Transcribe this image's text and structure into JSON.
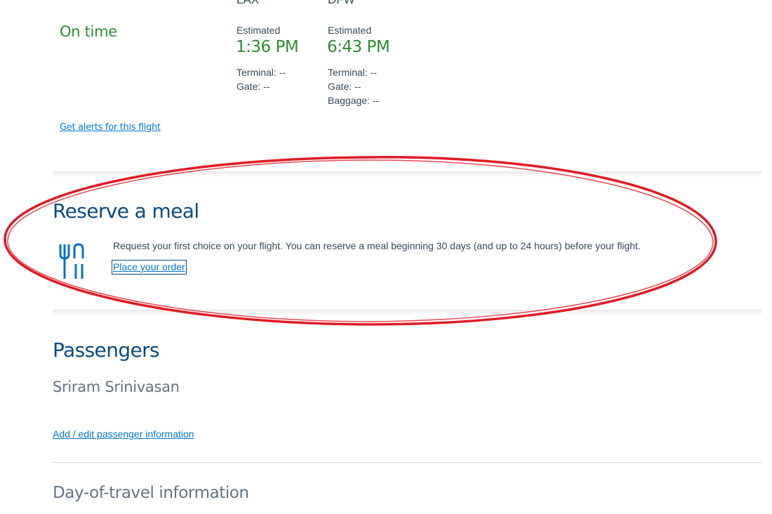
{
  "flight": {
    "status": "On time",
    "origin": {
      "code": "LAX",
      "estimated_label": "Estimated",
      "estimated_time": "1:36 PM",
      "terminal": "Terminal: --",
      "gate": "Gate: --"
    },
    "destination": {
      "code": "DFW",
      "estimated_label": "Estimated",
      "estimated_time": "6:43 PM",
      "terminal": "Terminal: --",
      "gate": "Gate: --",
      "baggage": "Baggage: --"
    },
    "alerts_link": "Get alerts for this flight"
  },
  "meal": {
    "title": "Reserve a meal",
    "icon": "utensils-icon",
    "description": "Request your first choice on your flight. You can reserve a meal beginning 30 days (and up to 24 hours) before your flight.",
    "order_link": "Place your order"
  },
  "passengers": {
    "title": "Passengers",
    "names": [
      "Sriram Srinivasan"
    ],
    "edit_link": "Add / edit passenger information"
  },
  "day_of_travel": {
    "title": "Day-of-travel information"
  },
  "colors": {
    "on_time_green": "#2e8b34",
    "heading_blue": "#0b4a7e",
    "link_blue": "#0078d2",
    "annotation_red": "#e01b24"
  }
}
